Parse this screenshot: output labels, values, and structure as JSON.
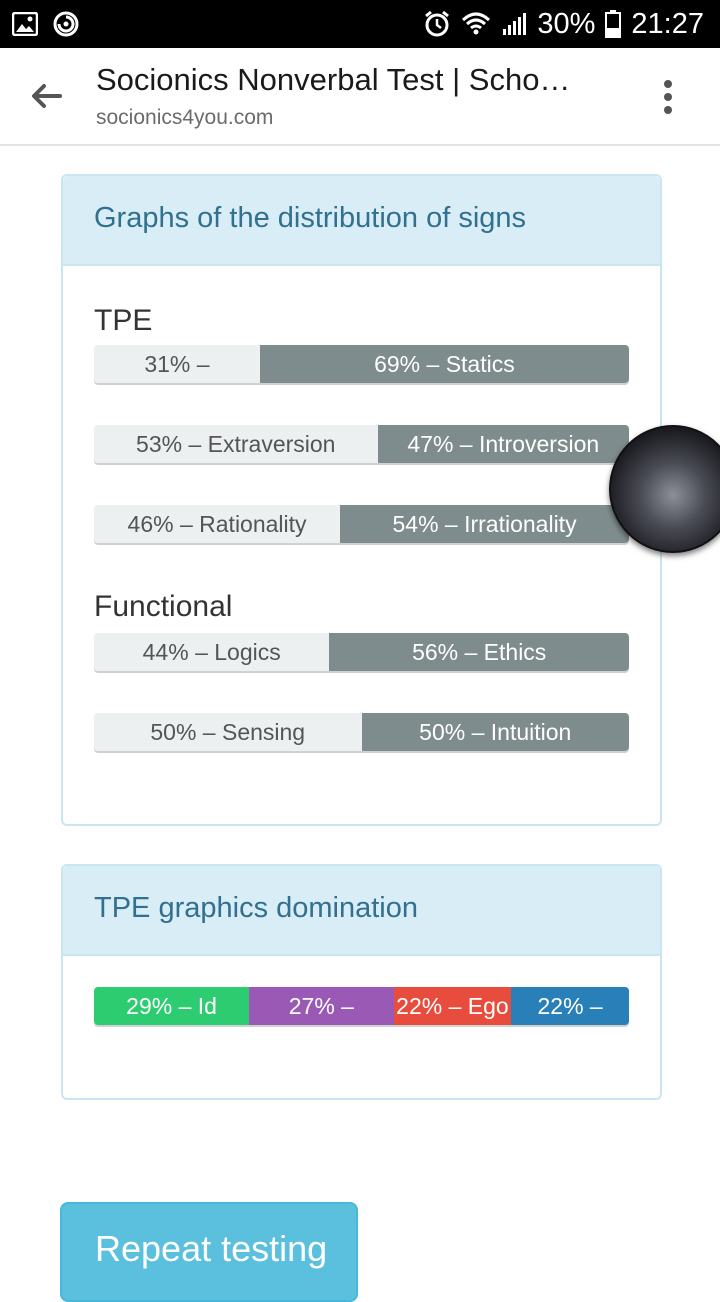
{
  "status_bar": {
    "battery": "30%",
    "time": "21:27",
    "icons": [
      "image-icon",
      "sync-icon",
      "alarm-icon",
      "wifi-icon",
      "signal-icon",
      "battery-icon"
    ]
  },
  "browser": {
    "page_title": "Socionics Nonverbal Test | Scho…",
    "url": "socionics4you.com",
    "icons": [
      "back-arrow-icon",
      "overflow-menu-icon"
    ]
  },
  "distribution": {
    "heading": "Graphs of the distribution of signs",
    "tpe_label": "TPE",
    "functional_label": "Functional",
    "rows": [
      {
        "left_label": "31% –",
        "right_label": "69% – Statics",
        "left_pct": 31
      },
      {
        "left_label": "53% – Extraversion",
        "right_label": "47% – Introversion",
        "left_pct": 53
      },
      {
        "left_label": "46% – Rationality",
        "right_label": "54% – Irrationality",
        "left_pct": 46
      },
      {
        "left_label": "44% – Logics",
        "right_label": "56% – Ethics",
        "left_pct": 44
      },
      {
        "left_label": "50% – Sensing",
        "right_label": "50% – Intuition",
        "left_pct": 50
      }
    ]
  },
  "domination": {
    "heading": "TPE graphics domination",
    "segments": [
      {
        "label": "29% – Id",
        "pct": 29,
        "color": "#2ecc71"
      },
      {
        "label": "27% –",
        "pct": 27,
        "color": "#9b59b6"
      },
      {
        "label": "22% – Ego",
        "pct": 22,
        "color": "#e74c3c"
      },
      {
        "label": "22% –",
        "pct": 22,
        "color": "#2980b9"
      }
    ]
  },
  "repeat_button": "Repeat testing"
}
